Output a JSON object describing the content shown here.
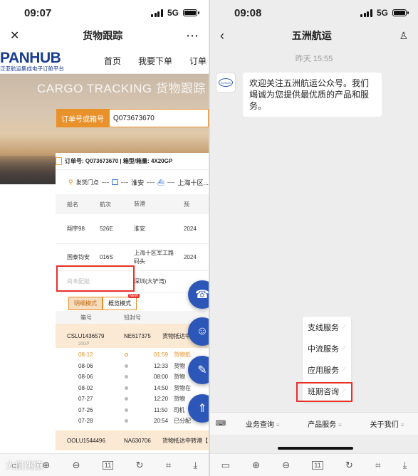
{
  "left": {
    "status": {
      "time": "09:07",
      "network": "5G"
    },
    "navbar": {
      "close": "✕",
      "title": "货物跟踪",
      "more": "⋯"
    },
    "site": {
      "logo_main": "PANHUB",
      "logo_sub": "泛亚航运集成电子订舱平台",
      "nav": [
        "首页",
        "我要下单",
        "订单"
      ]
    },
    "hero": {
      "banner": "CARGO TRACKING 货物跟踪"
    },
    "search": {
      "label": "订单号或箱号",
      "value": "Q073673670"
    },
    "order": {
      "text": "订单号: Q073673670 | 箱型/箱量: 4X20GP"
    },
    "route": {
      "start": "发货门点",
      "mid": "淮安",
      "end": "上海十区..."
    },
    "voyage_table": {
      "headers": [
        "船名",
        "航次",
        "装港",
        "预"
      ],
      "rows": [
        {
          "ship": "翔宇98",
          "voyage": "526E",
          "port": "淮安",
          "eta": "2024"
        },
        {
          "ship": "国泰钧安",
          "voyage": "016S",
          "port": "上海十区军工路码头",
          "eta": "2024"
        },
        {
          "ship": "尚未配船",
          "voyage": "",
          "port": "深圳(大铲湾)",
          "eta": ""
        }
      ]
    },
    "modes": {
      "detail": "明细模式",
      "overview": "概览模式",
      "badge": "NEW"
    },
    "container_table": {
      "headers": [
        "箱号",
        "铅封号"
      ],
      "container1": {
        "no": "CSLU1436579",
        "size": "20GP",
        "seal": "NE617375",
        "status": "货物抵达中"
      },
      "events": [
        {
          "date": "08-12",
          "time": "01:59",
          "desc": "货物抵"
        },
        {
          "date": "08-06",
          "time": "12:33",
          "desc": "货物"
        },
        {
          "date": "08-06",
          "time": "08:00",
          "desc": "货物"
        },
        {
          "date": "08-02",
          "time": "14:50",
          "desc": "货物在"
        },
        {
          "date": "07-27",
          "time": "12:20",
          "desc": "货物"
        },
        {
          "date": "07-26",
          "time": "11:50",
          "desc": "司机"
        },
        {
          "date": "07-28",
          "time": "20:54",
          "desc": "已分配"
        }
      ],
      "container2": {
        "no": "OOLU1544496",
        "seal": "NA630706",
        "status": "货物抵达中转港【"
      }
    },
    "watermark": "大鼠跳蹦",
    "bottom": {
      "page": "11"
    }
  },
  "right": {
    "status": {
      "time": "09:08",
      "network": "5G"
    },
    "navbar": {
      "title": "五洲航运"
    },
    "chat": {
      "time": "昨天 15:55",
      "avatar_text": "COSCO",
      "message": "欢迎关注五洲航运公众号。我们竭诚为您提供最优质的产品和服务。"
    },
    "menu": [
      "支线服务",
      "中流服务",
      "应用服务",
      "班期咨询"
    ],
    "bottom_menu": [
      "业务查询",
      "产品服务",
      "关于我们"
    ],
    "bottom": {
      "page": "11"
    }
  },
  "colors": {
    "accent": "#e9912a",
    "brand_blue": "#2c56b8",
    "highlight": "#e8302b"
  }
}
